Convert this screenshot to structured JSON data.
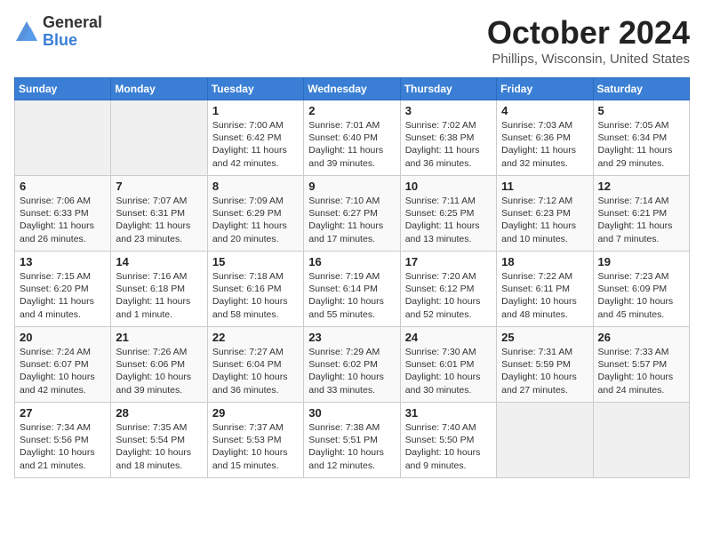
{
  "header": {
    "logo_general": "General",
    "logo_blue": "Blue",
    "title": "October 2024",
    "location": "Phillips, Wisconsin, United States"
  },
  "weekdays": [
    "Sunday",
    "Monday",
    "Tuesday",
    "Wednesday",
    "Thursday",
    "Friday",
    "Saturday"
  ],
  "weeks": [
    [
      {
        "day": "",
        "info": ""
      },
      {
        "day": "",
        "info": ""
      },
      {
        "day": "1",
        "info": "Sunrise: 7:00 AM\nSunset: 6:42 PM\nDaylight: 11 hours\nand 42 minutes."
      },
      {
        "day": "2",
        "info": "Sunrise: 7:01 AM\nSunset: 6:40 PM\nDaylight: 11 hours\nand 39 minutes."
      },
      {
        "day": "3",
        "info": "Sunrise: 7:02 AM\nSunset: 6:38 PM\nDaylight: 11 hours\nand 36 minutes."
      },
      {
        "day": "4",
        "info": "Sunrise: 7:03 AM\nSunset: 6:36 PM\nDaylight: 11 hours\nand 32 minutes."
      },
      {
        "day": "5",
        "info": "Sunrise: 7:05 AM\nSunset: 6:34 PM\nDaylight: 11 hours\nand 29 minutes."
      }
    ],
    [
      {
        "day": "6",
        "info": "Sunrise: 7:06 AM\nSunset: 6:33 PM\nDaylight: 11 hours\nand 26 minutes."
      },
      {
        "day": "7",
        "info": "Sunrise: 7:07 AM\nSunset: 6:31 PM\nDaylight: 11 hours\nand 23 minutes."
      },
      {
        "day": "8",
        "info": "Sunrise: 7:09 AM\nSunset: 6:29 PM\nDaylight: 11 hours\nand 20 minutes."
      },
      {
        "day": "9",
        "info": "Sunrise: 7:10 AM\nSunset: 6:27 PM\nDaylight: 11 hours\nand 17 minutes."
      },
      {
        "day": "10",
        "info": "Sunrise: 7:11 AM\nSunset: 6:25 PM\nDaylight: 11 hours\nand 13 minutes."
      },
      {
        "day": "11",
        "info": "Sunrise: 7:12 AM\nSunset: 6:23 PM\nDaylight: 11 hours\nand 10 minutes."
      },
      {
        "day": "12",
        "info": "Sunrise: 7:14 AM\nSunset: 6:21 PM\nDaylight: 11 hours\nand 7 minutes."
      }
    ],
    [
      {
        "day": "13",
        "info": "Sunrise: 7:15 AM\nSunset: 6:20 PM\nDaylight: 11 hours\nand 4 minutes."
      },
      {
        "day": "14",
        "info": "Sunrise: 7:16 AM\nSunset: 6:18 PM\nDaylight: 11 hours\nand 1 minute."
      },
      {
        "day": "15",
        "info": "Sunrise: 7:18 AM\nSunset: 6:16 PM\nDaylight: 10 hours\nand 58 minutes."
      },
      {
        "day": "16",
        "info": "Sunrise: 7:19 AM\nSunset: 6:14 PM\nDaylight: 10 hours\nand 55 minutes."
      },
      {
        "day": "17",
        "info": "Sunrise: 7:20 AM\nSunset: 6:12 PM\nDaylight: 10 hours\nand 52 minutes."
      },
      {
        "day": "18",
        "info": "Sunrise: 7:22 AM\nSunset: 6:11 PM\nDaylight: 10 hours\nand 48 minutes."
      },
      {
        "day": "19",
        "info": "Sunrise: 7:23 AM\nSunset: 6:09 PM\nDaylight: 10 hours\nand 45 minutes."
      }
    ],
    [
      {
        "day": "20",
        "info": "Sunrise: 7:24 AM\nSunset: 6:07 PM\nDaylight: 10 hours\nand 42 minutes."
      },
      {
        "day": "21",
        "info": "Sunrise: 7:26 AM\nSunset: 6:06 PM\nDaylight: 10 hours\nand 39 minutes."
      },
      {
        "day": "22",
        "info": "Sunrise: 7:27 AM\nSunset: 6:04 PM\nDaylight: 10 hours\nand 36 minutes."
      },
      {
        "day": "23",
        "info": "Sunrise: 7:29 AM\nSunset: 6:02 PM\nDaylight: 10 hours\nand 33 minutes."
      },
      {
        "day": "24",
        "info": "Sunrise: 7:30 AM\nSunset: 6:01 PM\nDaylight: 10 hours\nand 30 minutes."
      },
      {
        "day": "25",
        "info": "Sunrise: 7:31 AM\nSunset: 5:59 PM\nDaylight: 10 hours\nand 27 minutes."
      },
      {
        "day": "26",
        "info": "Sunrise: 7:33 AM\nSunset: 5:57 PM\nDaylight: 10 hours\nand 24 minutes."
      }
    ],
    [
      {
        "day": "27",
        "info": "Sunrise: 7:34 AM\nSunset: 5:56 PM\nDaylight: 10 hours\nand 21 minutes."
      },
      {
        "day": "28",
        "info": "Sunrise: 7:35 AM\nSunset: 5:54 PM\nDaylight: 10 hours\nand 18 minutes."
      },
      {
        "day": "29",
        "info": "Sunrise: 7:37 AM\nSunset: 5:53 PM\nDaylight: 10 hours\nand 15 minutes."
      },
      {
        "day": "30",
        "info": "Sunrise: 7:38 AM\nSunset: 5:51 PM\nDaylight: 10 hours\nand 12 minutes."
      },
      {
        "day": "31",
        "info": "Sunrise: 7:40 AM\nSunset: 5:50 PM\nDaylight: 10 hours\nand 9 minutes."
      },
      {
        "day": "",
        "info": ""
      },
      {
        "day": "",
        "info": ""
      }
    ]
  ]
}
